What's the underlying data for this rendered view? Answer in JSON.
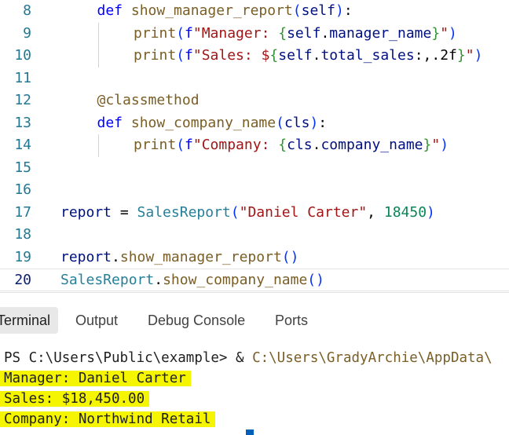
{
  "editor": {
    "lines": [
      {
        "num": "8",
        "indent": 1,
        "tokens": [
          {
            "t": "def ",
            "c": "kw"
          },
          {
            "t": "show_manager_report",
            "c": "fn"
          },
          {
            "t": "(",
            "c": "br1"
          },
          {
            "t": "self",
            "c": "var"
          },
          {
            "t": ")",
            "c": "br1"
          },
          {
            "t": ":",
            "c": "pl"
          }
        ]
      },
      {
        "num": "9",
        "indent": 2,
        "tokens": [
          {
            "t": "print",
            "c": "fn"
          },
          {
            "t": "(",
            "c": "br1"
          },
          {
            "t": "f",
            "c": "kw"
          },
          {
            "t": "\"Manager: ",
            "c": "str"
          },
          {
            "t": "{",
            "c": "br2"
          },
          {
            "t": "self",
            "c": "var"
          },
          {
            "t": ".",
            "c": "pl"
          },
          {
            "t": "manager_name",
            "c": "var"
          },
          {
            "t": "}",
            "c": "br2"
          },
          {
            "t": "\"",
            "c": "str"
          },
          {
            "t": ")",
            "c": "br1"
          }
        ]
      },
      {
        "num": "10",
        "indent": 2,
        "tokens": [
          {
            "t": "print",
            "c": "fn"
          },
          {
            "t": "(",
            "c": "br1"
          },
          {
            "t": "f",
            "c": "kw"
          },
          {
            "t": "\"Sales: $",
            "c": "str"
          },
          {
            "t": "{",
            "c": "br2"
          },
          {
            "t": "self",
            "c": "var"
          },
          {
            "t": ".",
            "c": "pl"
          },
          {
            "t": "total_sales",
            "c": "var"
          },
          {
            "t": ":,.2f",
            "c": "pl"
          },
          {
            "t": "}",
            "c": "br2"
          },
          {
            "t": "\"",
            "c": "str"
          },
          {
            "t": ")",
            "c": "br1"
          }
        ]
      },
      {
        "num": "11",
        "indent": 0,
        "tokens": []
      },
      {
        "num": "12",
        "indent": 1,
        "tokens": [
          {
            "t": "@",
            "c": "dec"
          },
          {
            "t": "classmethod",
            "c": "dec"
          }
        ]
      },
      {
        "num": "13",
        "indent": 1,
        "tokens": [
          {
            "t": "def ",
            "c": "kw"
          },
          {
            "t": "show_company_name",
            "c": "fn"
          },
          {
            "t": "(",
            "c": "br1"
          },
          {
            "t": "cls",
            "c": "var"
          },
          {
            "t": ")",
            "c": "br1"
          },
          {
            "t": ":",
            "c": "pl"
          }
        ]
      },
      {
        "num": "14",
        "indent": 2,
        "tokens": [
          {
            "t": "print",
            "c": "fn"
          },
          {
            "t": "(",
            "c": "br1"
          },
          {
            "t": "f",
            "c": "kw"
          },
          {
            "t": "\"Company: ",
            "c": "str"
          },
          {
            "t": "{",
            "c": "br2"
          },
          {
            "t": "cls",
            "c": "var"
          },
          {
            "t": ".",
            "c": "pl"
          },
          {
            "t": "company_name",
            "c": "var"
          },
          {
            "t": "}",
            "c": "br2"
          },
          {
            "t": "\"",
            "c": "str"
          },
          {
            "t": ")",
            "c": "br1"
          }
        ]
      },
      {
        "num": "15",
        "indent": 0,
        "tokens": []
      },
      {
        "num": "16",
        "indent": 0,
        "tokens": []
      },
      {
        "num": "17",
        "indent": 0,
        "tokens": [
          {
            "t": "report",
            "c": "var"
          },
          {
            "t": " = ",
            "c": "pl"
          },
          {
            "t": "SalesReport",
            "c": "cls"
          },
          {
            "t": "(",
            "c": "br1"
          },
          {
            "t": "\"Daniel Carter\"",
            "c": "str"
          },
          {
            "t": ", ",
            "c": "pl"
          },
          {
            "t": "18450",
            "c": "num"
          },
          {
            "t": ")",
            "c": "br1"
          }
        ]
      },
      {
        "num": "18",
        "indent": 0,
        "tokens": []
      },
      {
        "num": "19",
        "indent": 0,
        "tokens": [
          {
            "t": "report",
            "c": "var"
          },
          {
            "t": ".",
            "c": "pl"
          },
          {
            "t": "show_manager_report",
            "c": "fn"
          },
          {
            "t": "(",
            "c": "br1"
          },
          {
            "t": ")",
            "c": "br1"
          }
        ]
      },
      {
        "num": "20",
        "indent": 0,
        "current": true,
        "tokens": [
          {
            "t": "SalesReport",
            "c": "cls"
          },
          {
            "t": ".",
            "c": "pl"
          },
          {
            "t": "show_company_name",
            "c": "fn"
          },
          {
            "t": "(",
            "c": "br1"
          },
          {
            "t": ")",
            "c": "br1"
          }
        ]
      }
    ]
  },
  "panel": {
    "tabs": [
      {
        "label": "Terminal",
        "active": true
      },
      {
        "label": "Output",
        "active": false
      },
      {
        "label": "Debug Console",
        "active": false
      },
      {
        "label": "Ports",
        "active": false
      }
    ],
    "terminal": {
      "prompt_prefix": "PS C:\\Users\\Public\\example> & ",
      "prompt_path": "C:\\Users\\GradyArchie\\AppData\\",
      "output": [
        "Manager: Daniel Carter",
        "Sales: $18,450.00",
        "Company: Northwind Retail"
      ]
    }
  },
  "colors": {
    "keyword": "#0000ff",
    "function": "#795e26",
    "class": "#267f99",
    "string": "#a31515",
    "number": "#098658",
    "variable": "#001080",
    "output_highlight": "#f5f500",
    "cursor": "#005fb8"
  }
}
